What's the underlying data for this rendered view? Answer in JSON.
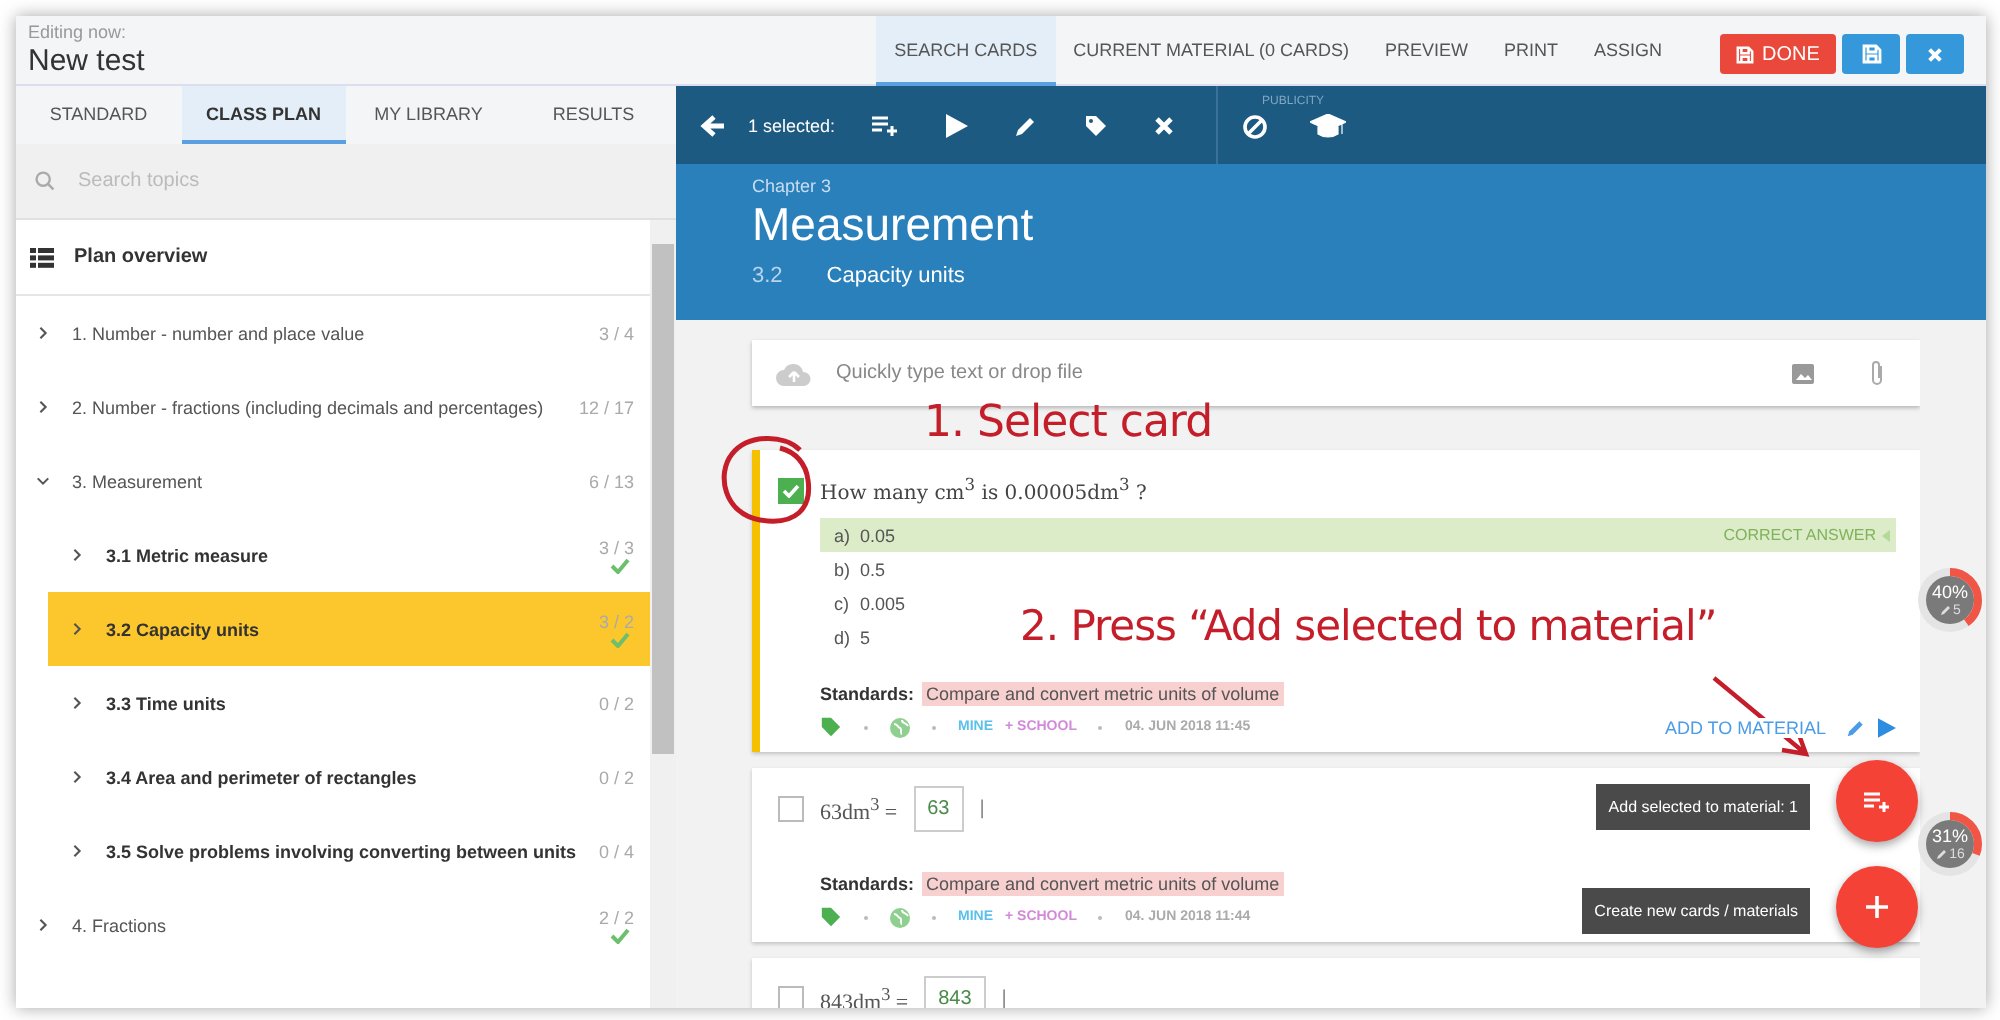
{
  "header": {
    "caption": "Editing now:",
    "title": "New test"
  },
  "top_tabs": [
    {
      "label": "SEARCH CARDS",
      "selected": true
    },
    {
      "label": "CURRENT MATERIAL (0 CARDS)",
      "selected": false
    },
    {
      "label": "PREVIEW",
      "selected": false
    },
    {
      "label": "PRINT",
      "selected": false
    },
    {
      "label": "ASSIGN",
      "selected": false
    }
  ],
  "done_button": "DONE",
  "side_tabs": [
    {
      "label": "STANDARD",
      "selected": false
    },
    {
      "label": "CLASS PLAN",
      "selected": true
    },
    {
      "label": "MY LIBRARY",
      "selected": false
    },
    {
      "label": "RESULTS",
      "selected": false
    }
  ],
  "search": {
    "placeholder": "Search topics"
  },
  "plan": {
    "title": "Plan overview",
    "items": [
      {
        "label": "1. Number - number and place value",
        "count": "3 / 4",
        "complete": false,
        "expanded": false,
        "selected": false
      },
      {
        "label": "2. Number - fractions (including decimals and percentages)",
        "count": "12 / 17",
        "complete": false,
        "expanded": false,
        "selected": false
      },
      {
        "label": "3. Measurement",
        "count": "6 / 13",
        "complete": false,
        "expanded": true,
        "selected": false,
        "children": [
          {
            "label": "3.1  Metric measure",
            "count": "3 / 3",
            "complete": true,
            "selected": false
          },
          {
            "label": "3.2  Capacity units",
            "count": "3 / 2",
            "complete": true,
            "selected": true
          },
          {
            "label": "3.3  Time units",
            "count": "0 / 2",
            "complete": false,
            "selected": false
          },
          {
            "label": "3.4  Area and perimeter of rectangles",
            "count": "0 / 2",
            "complete": false,
            "selected": false
          },
          {
            "label": "3.5  Solve problems involving converting between units",
            "count": "0 / 4",
            "complete": false,
            "selected": false
          }
        ]
      },
      {
        "label": "4. Fractions",
        "count": "2 / 2",
        "complete": true,
        "expanded": false,
        "selected": false
      }
    ]
  },
  "toolbar": {
    "selected_count": "1 selected:",
    "publicity_label": "PUBLICITY"
  },
  "chapter": {
    "caption": "Chapter 3",
    "title": "Measurement",
    "section_number": "3.2",
    "section_title": "Capacity units"
  },
  "quick_input": {
    "placeholder": "Quickly type text or drop file"
  },
  "cards": [
    {
      "kind": "choice",
      "checked": true,
      "question": "How many cm$^{3}$ is 0.00005dm$^{3}$ ?",
      "correct_label": "CORRECT ANSWER",
      "options": [
        {
          "letter": "a)",
          "text": "0.05",
          "correct": true
        },
        {
          "letter": "b)",
          "text": "0.5",
          "correct": false
        },
        {
          "letter": "c)",
          "text": "0.005",
          "correct": false
        },
        {
          "letter": "d)",
          "text": "5",
          "correct": false
        }
      ],
      "standards_label": "Standards:",
      "standard": "Compare and convert metric units of volume",
      "owner": "MINE",
      "scope": "+ SCHOOL",
      "date": "04. JUN 2018 11:45",
      "action": "ADD TO MATERIAL"
    },
    {
      "kind": "fill",
      "checked": false,
      "prompt": "63dm$^{3}$ =",
      "answer": "63",
      "suffix": "|",
      "standards_label": "Standards:",
      "standard": "Compare and convert metric units of volume",
      "owner": "MINE",
      "scope": "+ SCHOOL",
      "date": "04. JUN 2018 11:44"
    },
    {
      "kind": "fill",
      "checked": false,
      "prompt": "843dm$^{3}$ =",
      "answer": "843",
      "suffix": "|"
    }
  ],
  "progress": [
    {
      "percent": "40%",
      "count": "5",
      "level": 0.4
    },
    {
      "percent": "31%",
      "count": "16",
      "level": 0.31
    }
  ],
  "fabs": [
    {
      "kind": "add-selected",
      "tooltip": "Add selected to material: 1"
    },
    {
      "kind": "create",
      "tooltip": "Create new cards / materials"
    }
  ],
  "annotations": [
    {
      "text": "1. Select card"
    },
    {
      "text": "2. Press “Add selected to material”"
    }
  ]
}
